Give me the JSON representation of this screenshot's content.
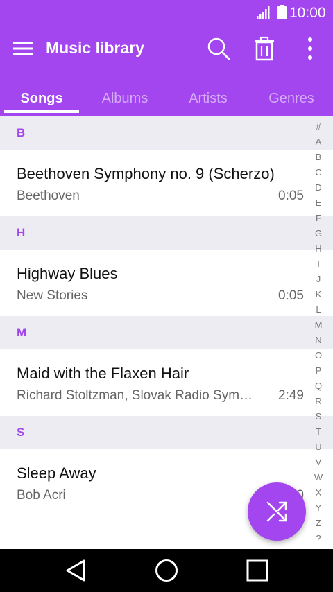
{
  "status_bar": {
    "time": "10:00"
  },
  "app_bar": {
    "title": "Music library",
    "icons": [
      "menu-icon",
      "search-icon",
      "trash-icon",
      "more-vert-icon"
    ]
  },
  "tabs": [
    {
      "label": "Songs",
      "active": true
    },
    {
      "label": "Albums",
      "active": false
    },
    {
      "label": "Artists",
      "active": false
    },
    {
      "label": "Genres",
      "active": false
    }
  ],
  "sections": [
    {
      "letter": "B",
      "songs": [
        {
          "title": "Beethoven Symphony no. 9 (Scherzo)",
          "artist": "Beethoven",
          "duration": "0:05"
        }
      ]
    },
    {
      "letter": "H",
      "songs": [
        {
          "title": "Highway Blues",
          "artist": "New Stories",
          "duration": "0:05"
        }
      ]
    },
    {
      "letter": "M",
      "songs": [
        {
          "title": "Maid with the Flaxen Hair",
          "artist": "Richard Stoltzman, Slovak Radio Symphony Orchestra",
          "duration": "2:49"
        }
      ]
    },
    {
      "letter": "S",
      "songs": [
        {
          "title": "Sleep Away",
          "artist": "Bob Acri",
          "duration": "3:20"
        }
      ]
    }
  ],
  "index_letters": [
    "#",
    "A",
    "B",
    "C",
    "D",
    "E",
    "F",
    "G",
    "H",
    "I",
    "J",
    "K",
    "L",
    "M",
    "N",
    "O",
    "P",
    "Q",
    "R",
    "S",
    "T",
    "U",
    "V",
    "W",
    "X",
    "Y",
    "Z",
    "?"
  ],
  "fab": {
    "icon": "shuffle-icon"
  },
  "nav_bar": {
    "icons": [
      "back-icon",
      "home-icon",
      "recents-icon"
    ]
  },
  "colors": {
    "accent": "#a346ef",
    "section_bg": "#ececf2",
    "nav_bg": "#000000"
  }
}
